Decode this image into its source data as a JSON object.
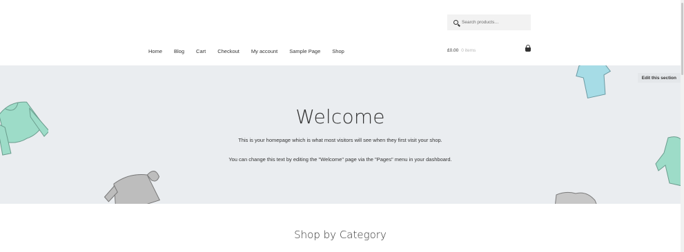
{
  "header": {
    "search": {
      "placeholder": "Search products…",
      "icon": "search-icon"
    },
    "nav": [
      "Home",
      "Blog",
      "Cart",
      "Checkout",
      "My account",
      "Sample Page",
      "Shop"
    ],
    "cart": {
      "total": "£0.00",
      "count": "0 items",
      "icon": "basket-icon"
    }
  },
  "hero": {
    "edit_label": "Edit this section",
    "title": "Welcome",
    "paragraph1": "This is your homepage which is what most visitors will see when they first visit your shop.",
    "paragraph2": "You can change this text by editing the \"Welcome\" page via the \"Pages\" menu in your dashboard."
  },
  "section": {
    "title": "Shop by Category"
  },
  "colors": {
    "hero_bg": "#eaedf0",
    "mint": "#8fd9c2",
    "grey_garment": "#b9b9b9"
  }
}
